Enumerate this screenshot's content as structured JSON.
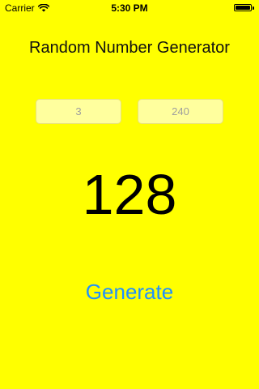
{
  "status_bar": {
    "carrier": "Carrier",
    "time": "5:30 PM",
    "wifi_icon": "wifi-icon",
    "battery_icon": "battery-icon"
  },
  "app": {
    "title": "Random Number Generator",
    "min_field": {
      "value": "3"
    },
    "max_field": {
      "value": "240"
    },
    "result": "128",
    "generate_label": "Generate"
  },
  "colors": {
    "background": "#ffff00",
    "field_background": "#ffff9e",
    "button_text": "#1e90ff"
  }
}
